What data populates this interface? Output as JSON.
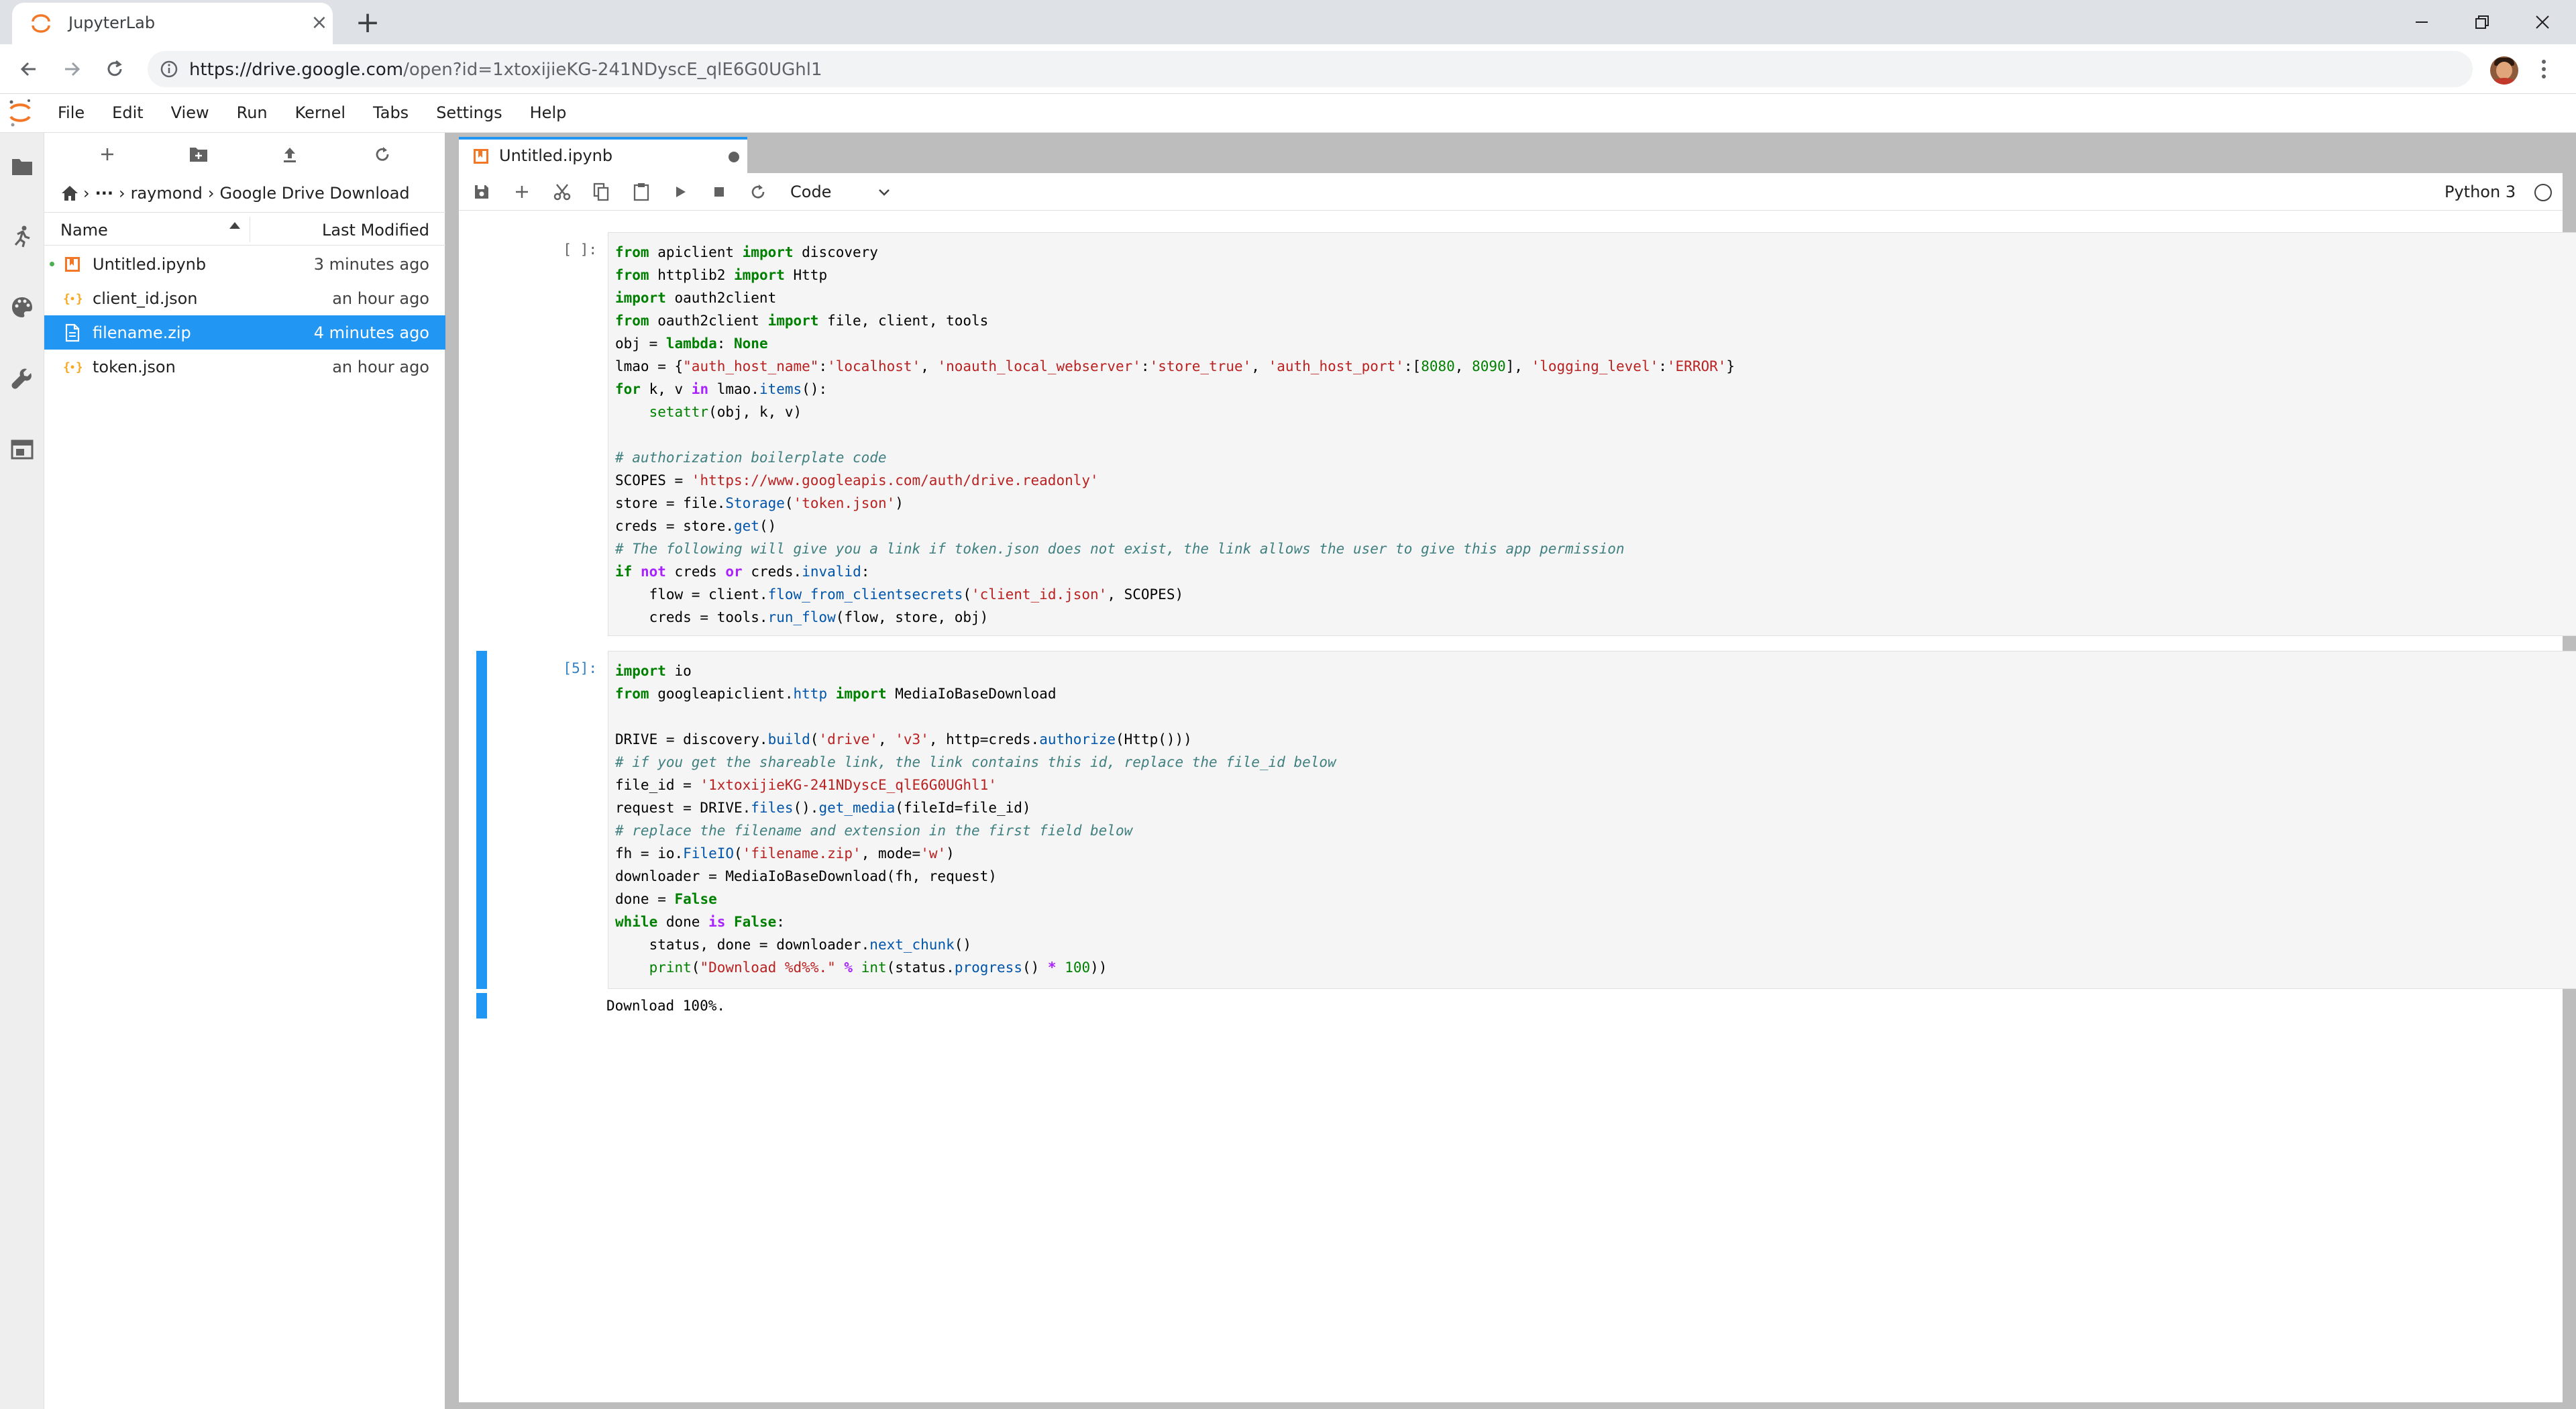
{
  "browser": {
    "tab_title": "JupyterLab",
    "new_tab_glyph": "+",
    "close_glyph": "×",
    "url_host": "https://drive.google.com",
    "url_rest": "/open?id=1xtoxijieKG-241NDyscE_qlE6G0UGhl1"
  },
  "menu": {
    "items": [
      "File",
      "Edit",
      "View",
      "Run",
      "Kernel",
      "Tabs",
      "Settings",
      "Help"
    ]
  },
  "activity_icons": [
    "folder-icon",
    "running-icon",
    "palette-icon",
    "wrench-icon",
    "tabs-icon"
  ],
  "filebrowser": {
    "breadcrumb": {
      "ellipsis": "···",
      "sep": "›",
      "parts": [
        "raymond",
        "Google Drive Download"
      ]
    },
    "header": {
      "name": "Name",
      "modified": "Last Modified"
    },
    "files": [
      {
        "name": "Untitled.ipynb",
        "modified": "3 minutes ago",
        "icon": "notebook-icon",
        "running": true,
        "selected": false
      },
      {
        "name": "client_id.json",
        "modified": "an hour ago",
        "icon": "json-icon",
        "running": false,
        "selected": false
      },
      {
        "name": "filename.zip",
        "modified": "4 minutes ago",
        "icon": "file-icon",
        "running": false,
        "selected": true
      },
      {
        "name": "token.json",
        "modified": "an hour ago",
        "icon": "json-icon",
        "running": false,
        "selected": false
      }
    ]
  },
  "notebook": {
    "tab_title": "Untitled.ipynb",
    "cell_type": "Code",
    "kernel": "Python 3",
    "cells": [
      {
        "prompt": "[ ]:"
      },
      {
        "prompt": "[5]:"
      }
    ],
    "output": "Download 100%."
  },
  "colors": {
    "accent": "#2196f3",
    "selected_row": "#2196f3",
    "jupyter_orange": "#f37726",
    "keyword": "#008000",
    "string": "#ba2121",
    "comment": "#408080"
  }
}
